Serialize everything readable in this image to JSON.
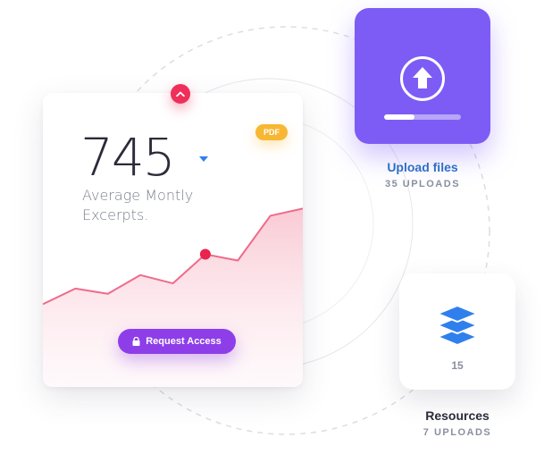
{
  "metric": {
    "value": "745",
    "label_line1": "Average Montly",
    "label_line2": "Excerpts.",
    "badge": "PDF",
    "button_label": "Request Access"
  },
  "chart_data": {
    "type": "area",
    "x": [
      0,
      1,
      2,
      3,
      4,
      5,
      6,
      7,
      8
    ],
    "values": [
      10,
      25,
      20,
      38,
      30,
      58,
      52,
      95,
      102
    ],
    "highlight_index": 5,
    "ylim": [
      0,
      110
    ],
    "title": "",
    "xlabel": "",
    "ylabel": "",
    "grid": false
  },
  "upload": {
    "title": "Upload files",
    "subtitle": "35 UPLOADS",
    "progress": 0.4,
    "icon": "upload-arrow-icon"
  },
  "resources": {
    "count": "15",
    "title": "Resources",
    "subtitle": "7 UPLOADS",
    "icon": "layers-icon"
  },
  "colors": {
    "accent_purple": "#8e3ee8",
    "upload_tile": "#7d5cf5",
    "pink": "#ef2f5a",
    "chart_line": "#f06a8a",
    "badge": "#f7b733",
    "link_blue": "#2f6fc4",
    "layers_blue": "#2f80ed"
  }
}
